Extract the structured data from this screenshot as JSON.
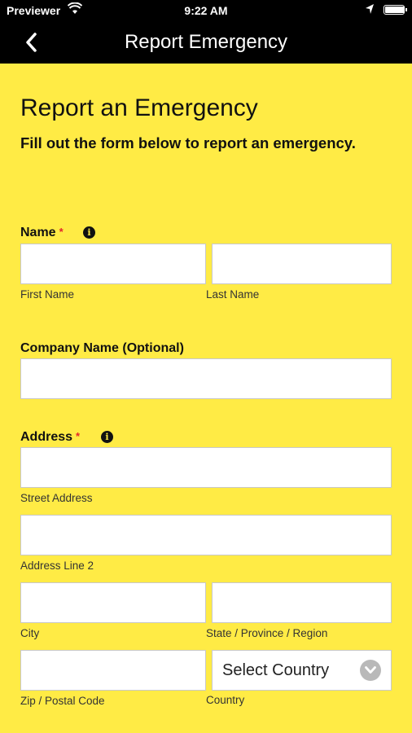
{
  "status_bar": {
    "carrier": "Previewer",
    "time": "9:22 AM"
  },
  "nav": {
    "title": "Report Emergency"
  },
  "page": {
    "heading": "Report an Emergency",
    "subtitle": "Fill out the form below to report an emergency."
  },
  "form": {
    "name_label": "Name",
    "required_mark": "*",
    "info_glyph": "i",
    "first_name_label": "First Name",
    "last_name_label": "Last Name",
    "company_label": "Company Name (Optional)",
    "address_label": "Address",
    "street_label": "Street Address",
    "address2_label": "Address Line 2",
    "city_label": "City",
    "state_label": "State / Province / Region",
    "zip_label": "Zip / Postal Code",
    "country_label": "Country",
    "country_value": "Select Country"
  },
  "colors": {
    "background": "#ffeb45",
    "bar": "#000000",
    "required": "#e3262a"
  }
}
